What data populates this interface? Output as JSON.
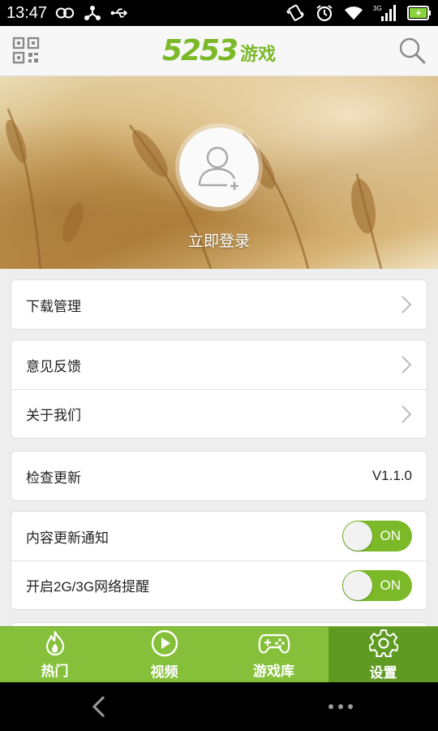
{
  "status_bar": {
    "time": "13:47",
    "network_label": "3G"
  },
  "header": {
    "logo_number": "5253",
    "logo_text": "游戏"
  },
  "profile": {
    "login_text": "立即登录"
  },
  "menu": {
    "download_manage": "下载管理",
    "feedback": "意见反馈",
    "about": "关于我们",
    "check_update": "检查更新",
    "version": "V1.1.0",
    "content_notify": "内容更新通知",
    "content_notify_state": "ON",
    "network_remind": "开启2G/3G网络提醒",
    "network_remind_state": "ON"
  },
  "tabs": [
    {
      "label": "热门",
      "icon": "flame-icon"
    },
    {
      "label": "视频",
      "icon": "play-icon"
    },
    {
      "label": "游戏库",
      "icon": "gamepad-icon"
    },
    {
      "label": "设置",
      "icon": "gear-icon"
    }
  ],
  "colors": {
    "accent": "#7cb928",
    "tab_bg": "#86c03a",
    "tab_active": "#5f9a22"
  }
}
